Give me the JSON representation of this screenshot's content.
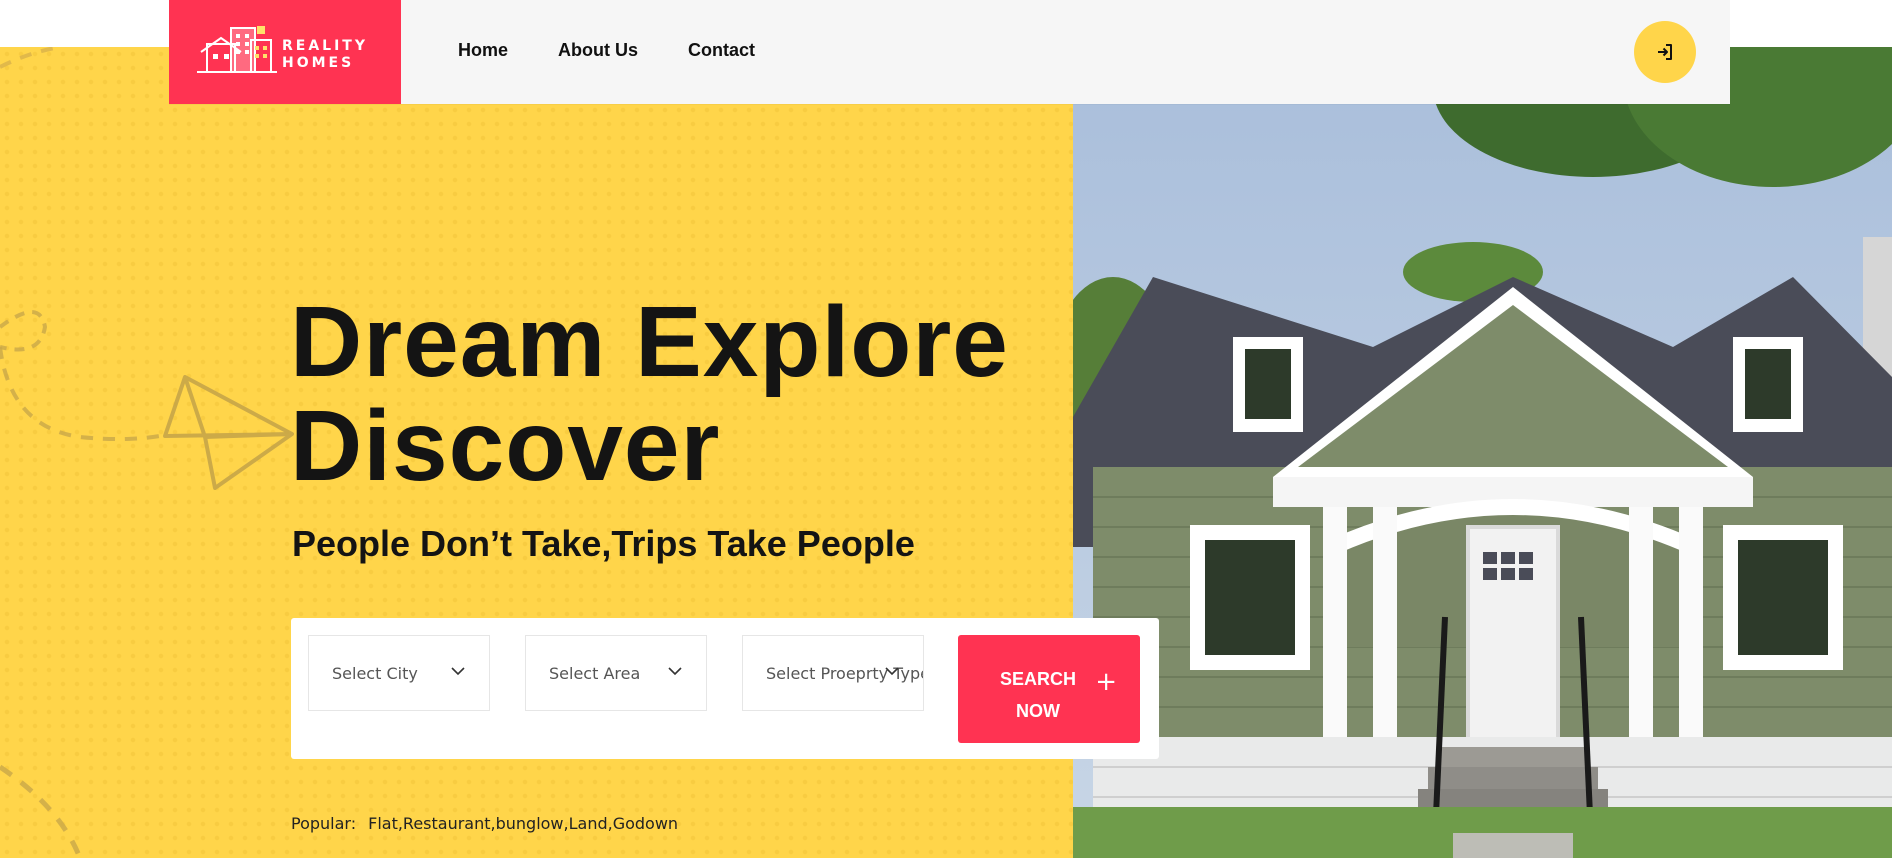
{
  "brand": {
    "logo_line1": "REALITY",
    "logo_line2": "HOMES",
    "logo_icon": "building-logo-icon"
  },
  "nav": {
    "items": [
      {
        "label": "Home"
      },
      {
        "label": "About Us"
      },
      {
        "label": "Contact"
      }
    ]
  },
  "header": {
    "login_icon": "sign-in-icon"
  },
  "hero": {
    "title_line1": "Dream Explore",
    "title_line2": "Discover",
    "subtitle": "People Don’t Take,Trips Take People",
    "decoration_icon": "paper-plane-icon",
    "image_subject": "house-photo"
  },
  "search": {
    "city": {
      "placeholder": "Select City"
    },
    "area": {
      "placeholder": "Select Area"
    },
    "property_type": {
      "placeholder": "Select Proeprty Type"
    },
    "button": {
      "label_line1": "SEARCH",
      "label_line2": "NOW",
      "icon": "plus-icon"
    }
  },
  "popular": {
    "label": "Popular:",
    "items": "Flat,Restaurant,bunglow,Land,Godown"
  },
  "colors": {
    "brand_red": "#FF3352",
    "brand_yellow": "#FFD54A",
    "header_bg": "#F6F6F6",
    "text_dark": "#141414"
  }
}
